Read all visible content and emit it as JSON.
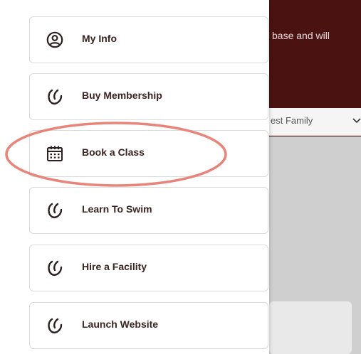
{
  "background": {
    "header_text": "base and will",
    "select_value": "est Family",
    "colors": {
      "header": "#4a1210",
      "body": "#cfcfcf"
    }
  },
  "menu": {
    "items": [
      {
        "label": "My Info",
        "icon": "user-circle-icon"
      },
      {
        "label": "Buy Membership",
        "icon": "brand-swirl-icon"
      },
      {
        "label": "Book a Class",
        "icon": "calendar-icon"
      },
      {
        "label": "Learn To Swim",
        "icon": "brand-swirl-icon"
      },
      {
        "label": "Hire a Facility",
        "icon": "brand-swirl-icon"
      },
      {
        "label": "Launch Website",
        "icon": "brand-swirl-icon"
      }
    ]
  },
  "annotation": {
    "highlighted_item": "Book a Class",
    "color": "#e8847a"
  }
}
